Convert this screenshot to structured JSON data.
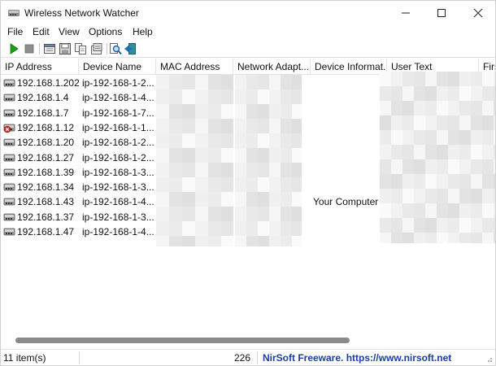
{
  "window": {
    "title": "Wireless Network Watcher"
  },
  "menu": [
    "File",
    "Edit",
    "View",
    "Options",
    "Help"
  ],
  "toolbar": {
    "icons": [
      "play-icon",
      "stop-icon",
      "html-report-icon",
      "save-icon",
      "copy-icon",
      "properties-icon",
      "find-icon",
      "exit-icon"
    ]
  },
  "table": {
    "columns": [
      "IP Address",
      "Device Name",
      "MAC Address",
      "Network Adapt...",
      "Device Informat...",
      "User Text",
      "Firs"
    ],
    "rows": [
      {
        "ip": "192.168.1.202",
        "device": "ip-192-168-1-2...",
        "info": "",
        "status": "ok"
      },
      {
        "ip": "192.168.1.4",
        "device": "ip-192-168-1-4...",
        "info": "",
        "status": "ok"
      },
      {
        "ip": "192.168.1.7",
        "device": "ip-192-168-1-7...",
        "info": "",
        "status": "ok"
      },
      {
        "ip": "192.168.1.12",
        "device": "ip-192-168-1-1...",
        "info": "",
        "status": "offline"
      },
      {
        "ip": "192.168.1.20",
        "device": "ip-192-168-1-2...",
        "info": "",
        "status": "ok"
      },
      {
        "ip": "192.168.1.27",
        "device": "ip-192-168-1-2...",
        "info": "",
        "status": "ok"
      },
      {
        "ip": "192.168.1.39",
        "device": "ip-192-168-1-3...",
        "info": "",
        "status": "ok"
      },
      {
        "ip": "192.168.1.34",
        "device": "ip-192-168-1-3...",
        "info": "",
        "status": "ok"
      },
      {
        "ip": "192.168.1.43",
        "device": "ip-192-168-1-4...",
        "info": "Your Computer",
        "status": "ok"
      },
      {
        "ip": "192.168.1.37",
        "device": "ip-192-168-1-3...",
        "info": "",
        "status": "ok"
      },
      {
        "ip": "192.168.1.47",
        "device": "ip-192-168-1-4...",
        "info": "",
        "status": "ok"
      }
    ]
  },
  "status": {
    "items": "11 item(s)",
    "count": "226",
    "link": "NirSoft Freeware. https://www.nirsoft.net"
  },
  "colors": {
    "link": "#1a3ea8",
    "play": "#19a019",
    "offline": "#d42a2a"
  }
}
